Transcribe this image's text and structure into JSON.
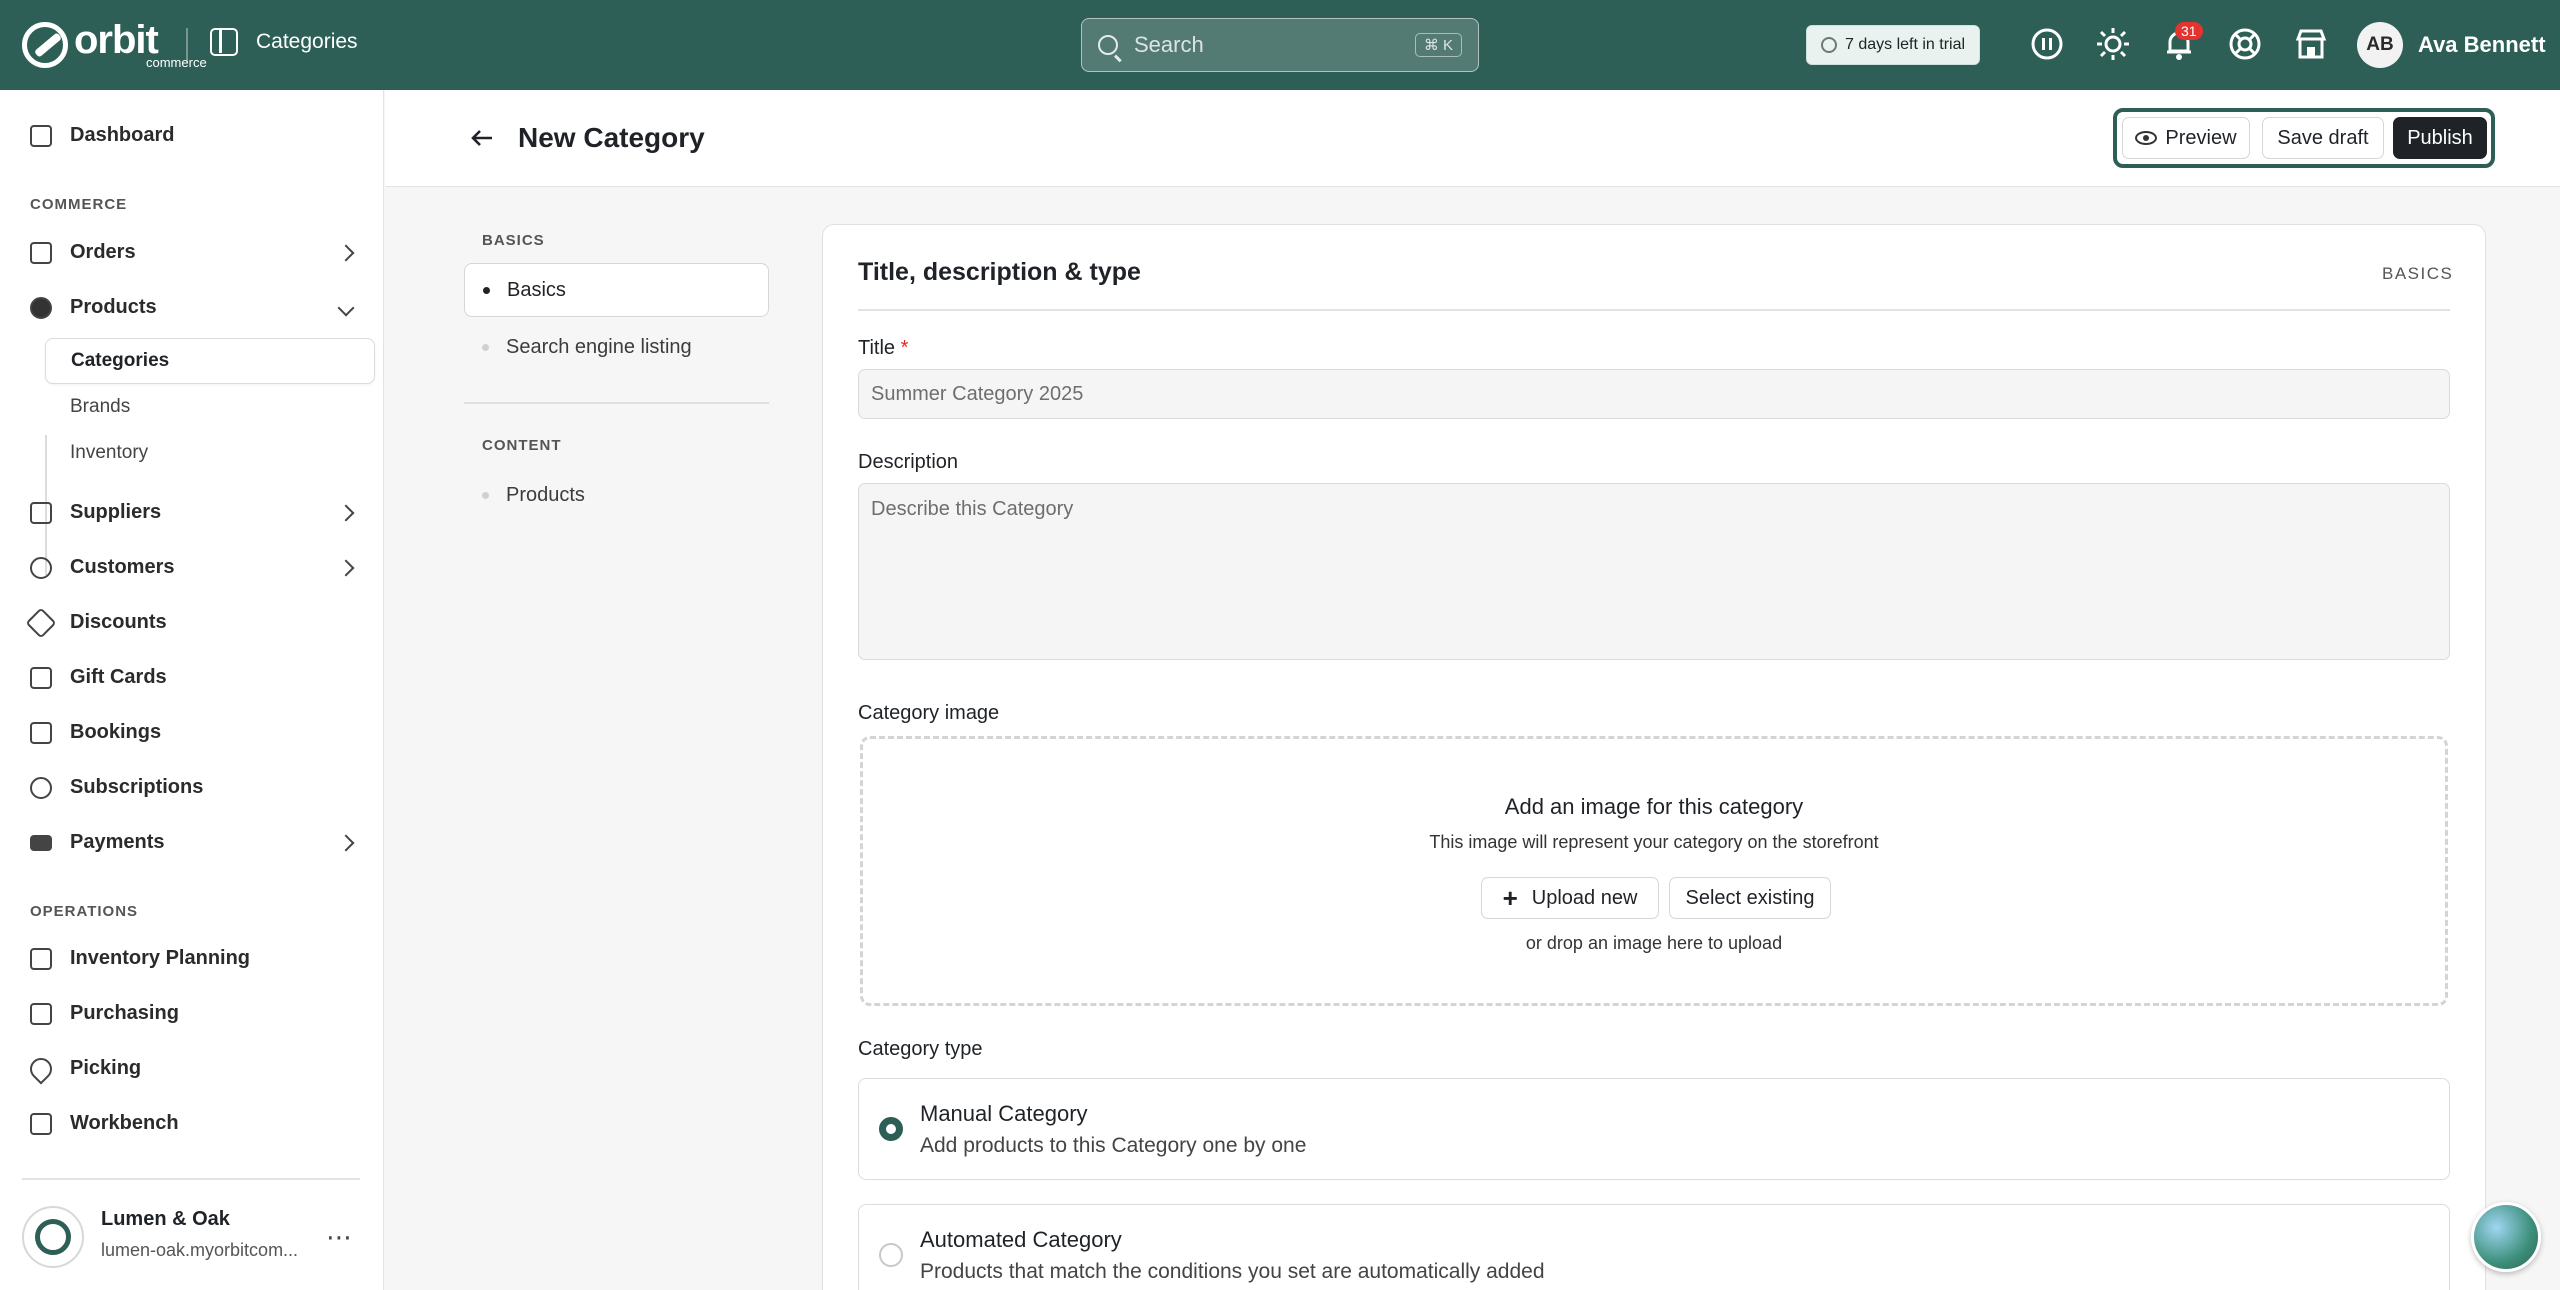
{
  "topbar": {
    "logo_main": "orbit",
    "logo_sub": "commerce",
    "section": "Categories",
    "search_placeholder": "Search",
    "search_shortcut": "⌘ K",
    "trial_text": "7 days left in trial",
    "notifications_count": "31",
    "user_initials": "AB",
    "user_name": "Ava Bennett",
    "accent_color": "#2e5f56"
  },
  "sidebar": {
    "dashboard": "Dashboard",
    "section_commerce": "COMMERCE",
    "orders": "Orders",
    "products": "Products",
    "products_sub": [
      "Categories",
      "Brands",
      "Inventory"
    ],
    "suppliers": "Suppliers",
    "customers": "Customers",
    "discounts": "Discounts",
    "gift_cards": "Gift Cards",
    "bookings": "Bookings",
    "subscriptions": "Subscriptions",
    "payments": "Payments",
    "section_operations": "OPERATIONS",
    "inventory_planning": "Inventory Planning",
    "purchasing": "Purchasing",
    "picking": "Picking",
    "workbench": "Workbench",
    "store_name": "Lumen & Oak",
    "store_url": "lumen-oak.myorbitcom..."
  },
  "header": {
    "title": "New Category",
    "preview": "Preview",
    "save_draft": "Save draft",
    "publish": "Publish"
  },
  "section_nav": {
    "basics_label": "BASICS",
    "basics": "Basics",
    "seo": "Search engine listing",
    "content_label": "CONTENT",
    "products": "Products"
  },
  "form": {
    "card_title": "Title, description & type",
    "card_tag": "BASICS",
    "title_label": "Title",
    "title_required": "*",
    "title_placeholder": "Summer Category 2025",
    "description_label": "Description",
    "description_placeholder": "Describe this Category",
    "image_label": "Category image",
    "image_title": "Add an image for this category",
    "image_sub": "This image will represent your category on the storefront",
    "upload_new": "Upload new",
    "select_existing": "Select existing",
    "drop_note": "or drop an image here to upload",
    "type_label": "Category type",
    "manual_title": "Manual Category",
    "manual_sub": "Add products to this Category one by one",
    "auto_title": "Automated Category",
    "auto_sub": "Products that match the conditions you set are automatically added"
  }
}
